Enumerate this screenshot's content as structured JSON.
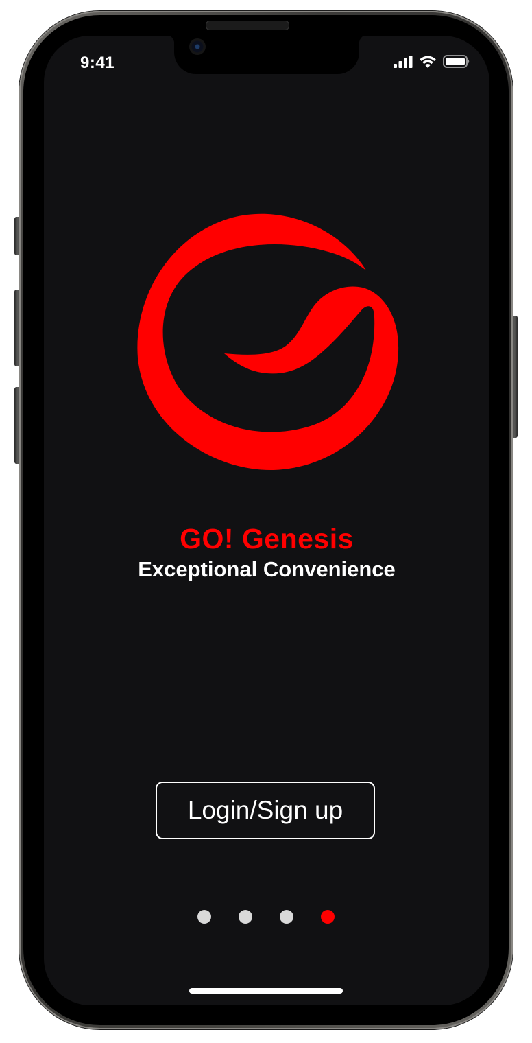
{
  "status_bar": {
    "time": "9:41",
    "icons": [
      "cellular-signal-icon",
      "wifi-icon",
      "battery-icon"
    ]
  },
  "logo": {
    "icon": "go-genesis-swirl-logo",
    "color": "#ff0000"
  },
  "brand": {
    "title": "GO! Genesis",
    "tagline": "Exceptional Convenience",
    "title_color": "#ff0000",
    "tagline_color": "#ffffff"
  },
  "login_button": {
    "label": "Login/Sign up"
  },
  "pagination": {
    "total": 4,
    "active_index": 3,
    "active_color": "#ff0000",
    "inactive_color": "#d9d9d9"
  },
  "theme": {
    "screen_background": "#111113"
  }
}
